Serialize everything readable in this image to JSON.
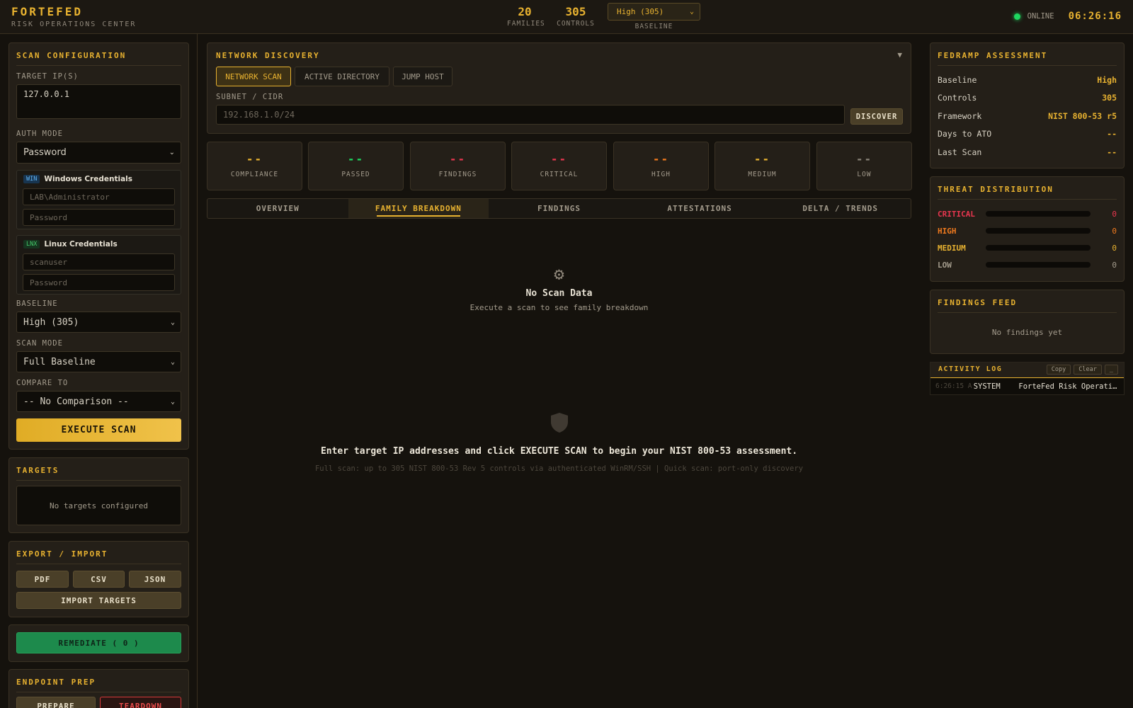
{
  "header": {
    "brand": "FORTEFED",
    "subtitle": "RISK OPERATIONS CENTER",
    "families_value": "20",
    "families_label": "FAMILIES",
    "controls_value": "305",
    "controls_label": "CONTROLS",
    "baseline_select": "High (305)",
    "baseline_label": "BASELINE",
    "status": "ONLINE",
    "clock": "06:26:16"
  },
  "scan_config": {
    "title": "SCAN CONFIGURATION",
    "target_label": "TARGET IP(S)",
    "target_value": "127.0.0.1",
    "auth_label": "AUTH MODE",
    "auth_value": "Password",
    "win_tag": "WIN",
    "win_title": "Windows Credentials",
    "win_user_placeholder": "LAB\\Administrator",
    "win_pass_placeholder": "Password",
    "lnx_tag": "LNX",
    "lnx_title": "Linux Credentials",
    "lnx_user_placeholder": "scanuser",
    "lnx_pass_placeholder": "Password",
    "baseline_label": "BASELINE",
    "baseline_value": "High (305)",
    "mode_label": "SCAN MODE",
    "mode_value": "Full Baseline",
    "compare_label": "COMPARE TO",
    "compare_value": "-- No Comparison --",
    "execute": "EXECUTE SCAN"
  },
  "targets": {
    "title": "TARGETS",
    "empty": "No targets configured"
  },
  "export": {
    "title": "EXPORT / IMPORT",
    "pdf": "PDF",
    "csv": "CSV",
    "json": "JSON",
    "import": "IMPORT TARGETS"
  },
  "remediate": {
    "label": "REMEDIATE ( 0 )"
  },
  "endpoint": {
    "title": "ENDPOINT PREP",
    "prepare": "PREPARE",
    "teardown": "TEARDOWN"
  },
  "network": {
    "title": "NETWORK DISCOVERY",
    "tabs": [
      "NETWORK SCAN",
      "ACTIVE DIRECTORY",
      "JUMP HOST"
    ],
    "subnet_label": "SUBNET / CIDR",
    "subnet_placeholder": "192.168.1.0/24",
    "discover": "DISCOVER"
  },
  "stats": [
    {
      "value": "--",
      "label": "COMPLIANCE",
      "color": "#e8b230"
    },
    {
      "value": "--",
      "label": "PASSED",
      "color": "#1ed760"
    },
    {
      "value": "--",
      "label": "FINDINGS",
      "color": "#e8364f"
    },
    {
      "value": "--",
      "label": "CRITICAL",
      "color": "#e8364f"
    },
    {
      "value": "--",
      "label": "HIGH",
      "color": "#f07a1e"
    },
    {
      "value": "--",
      "label": "MEDIUM",
      "color": "#e8b230"
    },
    {
      "value": "--",
      "label": "LOW",
      "color": "#8a8478"
    }
  ],
  "tabs": [
    "OVERVIEW",
    "FAMILY BREAKDOWN",
    "FINDINGS",
    "ATTESTATIONS",
    "DELTA / TRENDS"
  ],
  "empty_state": {
    "title": "No Scan Data",
    "subtitle": "Execute a scan to see family breakdown",
    "prompt": "Enter target IP addresses and click EXECUTE SCAN to begin your NIST 800-53 assessment.",
    "hint": "Full scan: up to 305 NIST 800-53 Rev 5 controls via authenticated WinRM/SSH | Quick scan: port-only discovery"
  },
  "fedramp": {
    "title": "FEDRAMP ASSESSMENT",
    "rows": [
      {
        "k": "Baseline",
        "v": "High"
      },
      {
        "k": "Controls",
        "v": "305"
      },
      {
        "k": "Framework",
        "v": "NIST 800-53 r5"
      },
      {
        "k": "Days to ATO",
        "v": "--"
      },
      {
        "k": "Last Scan",
        "v": "--"
      }
    ]
  },
  "threat": {
    "title": "THREAT DISTRIBUTION",
    "rows": [
      {
        "name": "CRITICAL",
        "count": "0",
        "color": "#e8364f",
        "fill": 0
      },
      {
        "name": "HIGH",
        "count": "0",
        "color": "#f07a1e",
        "fill": 0
      },
      {
        "name": "MEDIUM",
        "count": "0",
        "color": "#e8b230",
        "fill": 0
      },
      {
        "name": "LOW",
        "count": "0",
        "color": "#a39b8c",
        "fill": 0
      }
    ]
  },
  "feed": {
    "title": "FINDINGS FEED",
    "empty": "No findings yet"
  },
  "log": {
    "title": "ACTIVITY LOG",
    "copy": "Copy",
    "clear": "Clear",
    "min": "_",
    "entry_time": "6:26:15 A",
    "entry_source": "SYSTEM",
    "entry_msg": "ForteFed Risk Operatio…"
  }
}
